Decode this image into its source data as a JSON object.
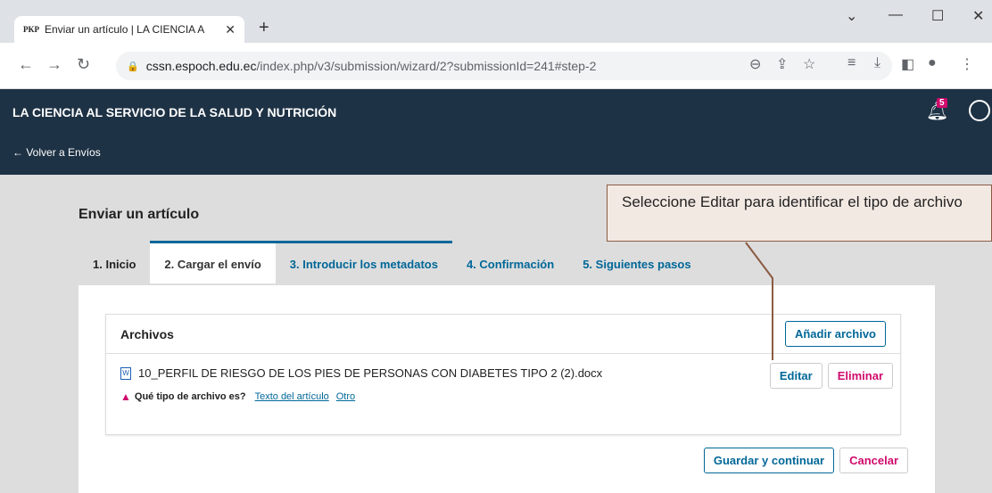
{
  "browser": {
    "tab_favicon": "PKP",
    "tab_title": "Enviar un artículo | LA CIENCIA A",
    "url_host": "cssn.espoch.edu.ec",
    "url_path": "/index.php/v3/submission/wizard/2?submissionId=241#step-2"
  },
  "site": {
    "title": "LA CIENCIA AL SERVICIO DE LA SALUD Y NUTRICIÓN",
    "notifications_count": "5",
    "back_link": "← Volver a Envíos"
  },
  "page": {
    "title": "Enviar un artículo",
    "steps": [
      "1. Inicio",
      "2. Cargar el envío",
      "3. Introducir los metadatos",
      "4. Confirmación",
      "5. Siguientes pasos"
    ]
  },
  "files": {
    "heading": "Archivos",
    "add_button": "Añadir archivo",
    "file_name": "10_PERFIL DE RIESGO DE LOS PIES DE PERSONAS CON DIABETES TIPO 2 (2).docx",
    "edit_button": "Editar",
    "delete_button": "Eliminar",
    "type_question": "Qué tipo de archivo es?",
    "type_option_1": "Texto del artículo",
    "type_option_2": "Otro"
  },
  "actions": {
    "save_button": "Guardar y continuar",
    "cancel_button": "Cancelar"
  },
  "callout": {
    "text": "Seleccione Editar para identificar el tipo de archivo"
  },
  "colors": {
    "header_bg": "#1e3245",
    "link": "#006798",
    "danger": "#d00a6c",
    "callout_bg": "#f3e9e3"
  }
}
